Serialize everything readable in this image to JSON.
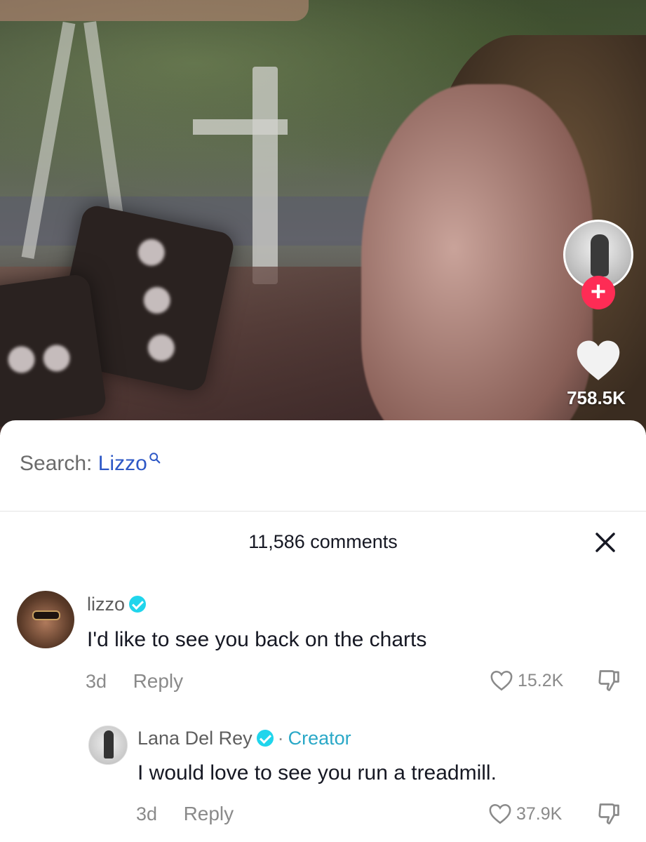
{
  "video": {
    "like_count": "758.5K",
    "follow_symbol": "+"
  },
  "search": {
    "prefix": "Search:",
    "term": "Lizzo"
  },
  "comments_header": {
    "count_label": "11,586 comments"
  },
  "comments": [
    {
      "username": "lizzo",
      "verified": true,
      "text": "I'd like to see you back on the charts",
      "age": "3d",
      "reply_label": "Reply",
      "likes": "15.2K"
    },
    {
      "username": "Lana Del Rey",
      "verified": true,
      "separator": "·",
      "tag": "Creator",
      "text": "I would love to see you run a treadmill.",
      "age": "3d",
      "reply_label": "Reply",
      "likes": "37.9K"
    }
  ],
  "colors": {
    "follow": "#fe2c55",
    "search_term": "#2e58c6",
    "verified": "#20d5ec",
    "creator_tag": "#2aa8c7"
  }
}
